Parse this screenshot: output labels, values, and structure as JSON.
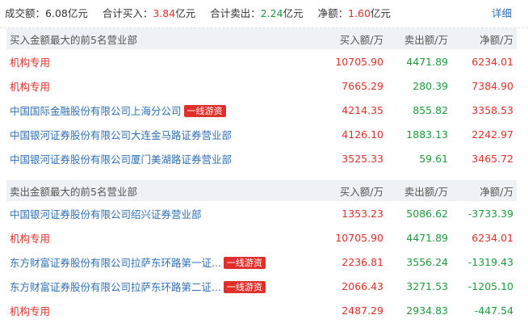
{
  "summary": {
    "turnover_label": "成交额：",
    "turnover_value": "6.08亿元",
    "buy_label": "合计买入：",
    "buy_value": "3.84",
    "buy_unit": "亿元",
    "sell_label": "合计卖出：",
    "sell_value": "2.24",
    "sell_unit": "亿元",
    "net_label": "净额：",
    "net_value": "1.60",
    "net_unit": "亿元",
    "detail_link": "详细"
  },
  "buy_table": {
    "title": "买入金额最大的前5名营业部",
    "col_buy": "买入额/万",
    "col_sell": "卖出额/万",
    "col_net": "净额/万",
    "rows": [
      {
        "name": "机构专用",
        "badge": "",
        "buy": "10705.90",
        "sell": "4471.89",
        "net": "6234.01"
      },
      {
        "name": "机构专用",
        "badge": "",
        "buy": "7665.29",
        "sell": "280.39",
        "net": "7384.90"
      },
      {
        "name": "中国国际金融股份有限公司上海分公司",
        "badge": "一线游资",
        "buy": "4214.35",
        "sell": "855.82",
        "net": "3358.53"
      },
      {
        "name": "中国银河证券股份有限公司大连金马路证券营业部",
        "badge": "",
        "buy": "4126.10",
        "sell": "1883.13",
        "net": "2242.97"
      },
      {
        "name": "中国银河证券股份有限公司厦门美湖路证券营业部",
        "badge": "",
        "buy": "3525.33",
        "sell": "59.61",
        "net": "3465.72"
      }
    ]
  },
  "sell_table": {
    "title": "卖出金额最大的前5名营业部",
    "col_buy": "买入额/万",
    "col_sell": "卖出额/万",
    "col_net": "净额/万",
    "rows": [
      {
        "name": "中国银河证券股份有限公司绍兴证券营业部",
        "badge": "",
        "buy": "1353.23",
        "sell": "5086.62",
        "net": "-3733.39"
      },
      {
        "name": "机构专用",
        "badge": "",
        "buy": "10705.90",
        "sell": "4471.89",
        "net": "6234.01"
      },
      {
        "name": "东方财富证券股份有限公司拉萨东环路第一证...",
        "badge": "一线游资",
        "buy": "2236.81",
        "sell": "3556.24",
        "net": "-1319.43"
      },
      {
        "name": "东方财富证券股份有限公司拉萨东环路第二证...",
        "badge": "一线游资",
        "buy": "2066.43",
        "sell": "3271.53",
        "net": "-1205.10"
      },
      {
        "name": "机构专用",
        "badge": "",
        "buy": "2487.29",
        "sell": "2934.83",
        "net": "-447.54"
      }
    ]
  },
  "colors": {
    "up": "#e0302b",
    "down": "#1e9a3c",
    "link": "#2f6fb3",
    "header_bg": "#eef1f5"
  }
}
